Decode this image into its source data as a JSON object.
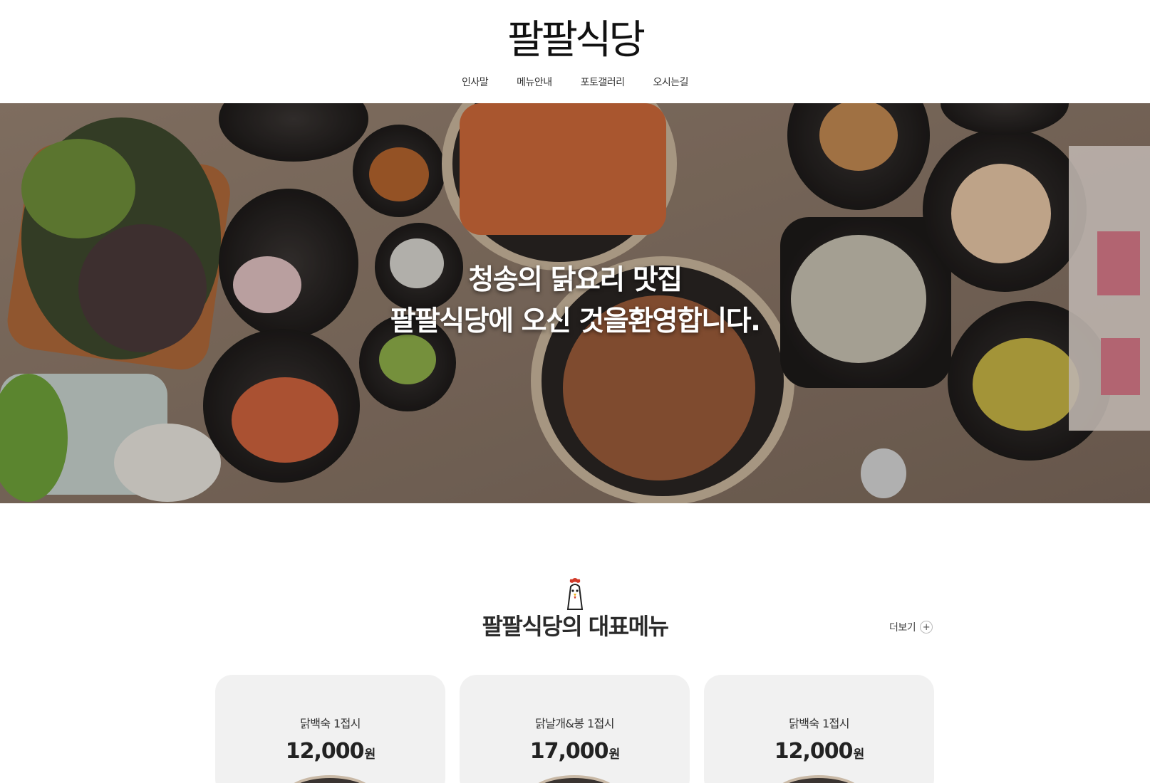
{
  "header": {
    "logo": "팔팔식당",
    "nav": [
      {
        "label": "인사말"
      },
      {
        "label": "메뉴안내"
      },
      {
        "label": "포토갤러리"
      },
      {
        "label": "오시는길"
      }
    ]
  },
  "hero": {
    "line1": "청송의 닭요리 맛집",
    "line2": "팔팔식당에 오신 것을환영합니다."
  },
  "menu_section": {
    "icon": "rooster-icon",
    "title": "팔팔식당의 대표메뉴",
    "more_label": "더보기",
    "more_icon": "plus-icon",
    "cards": [
      {
        "name": "닭백숙 1접시",
        "price": "12,000",
        "unit": "원"
      },
      {
        "name": "닭날개&봉 1접시",
        "price": "17,000",
        "unit": "원"
      },
      {
        "name": "닭백숙 1접시",
        "price": "12,000",
        "unit": "원"
      }
    ]
  }
}
